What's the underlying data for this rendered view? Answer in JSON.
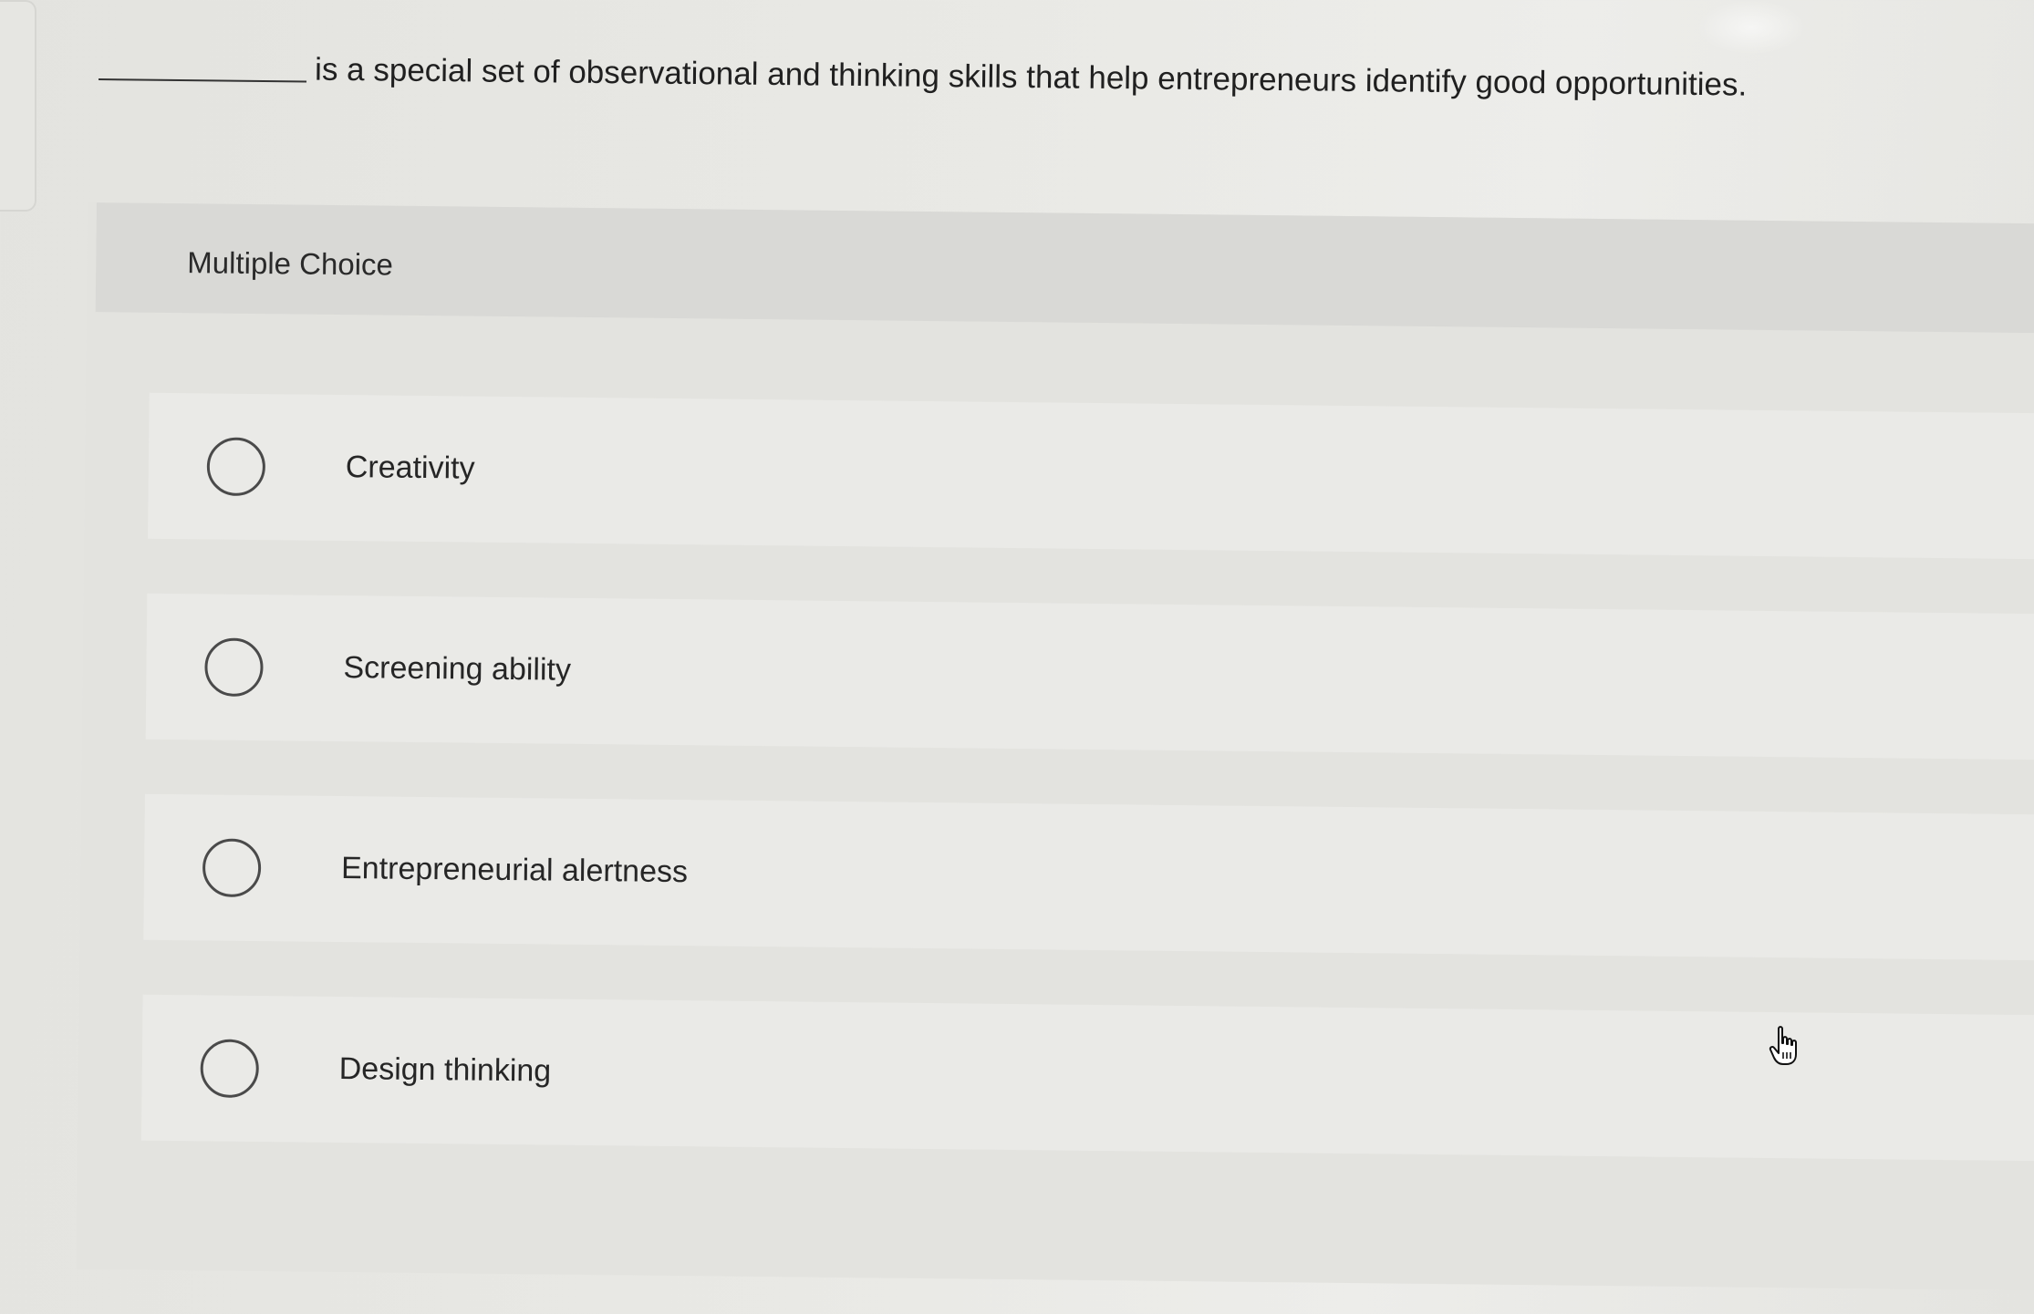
{
  "question": {
    "blank": "",
    "text": "is a special set of observational and thinking skills that help entrepreneurs identify good opportunities."
  },
  "section": {
    "label": "Multiple Choice"
  },
  "options": [
    {
      "label": "Creativity"
    },
    {
      "label": "Screening ability"
    },
    {
      "label": "Entrepreneurial alertness"
    },
    {
      "label": "Design thinking"
    }
  ],
  "cursor": {
    "icon": "hand-pointer-icon"
  },
  "colors": {
    "background": "#e9e9e5",
    "header": "#d9d9d6",
    "option_background": "#eaeae7",
    "radio_border": "#4a4a4a",
    "text": "#222222"
  }
}
